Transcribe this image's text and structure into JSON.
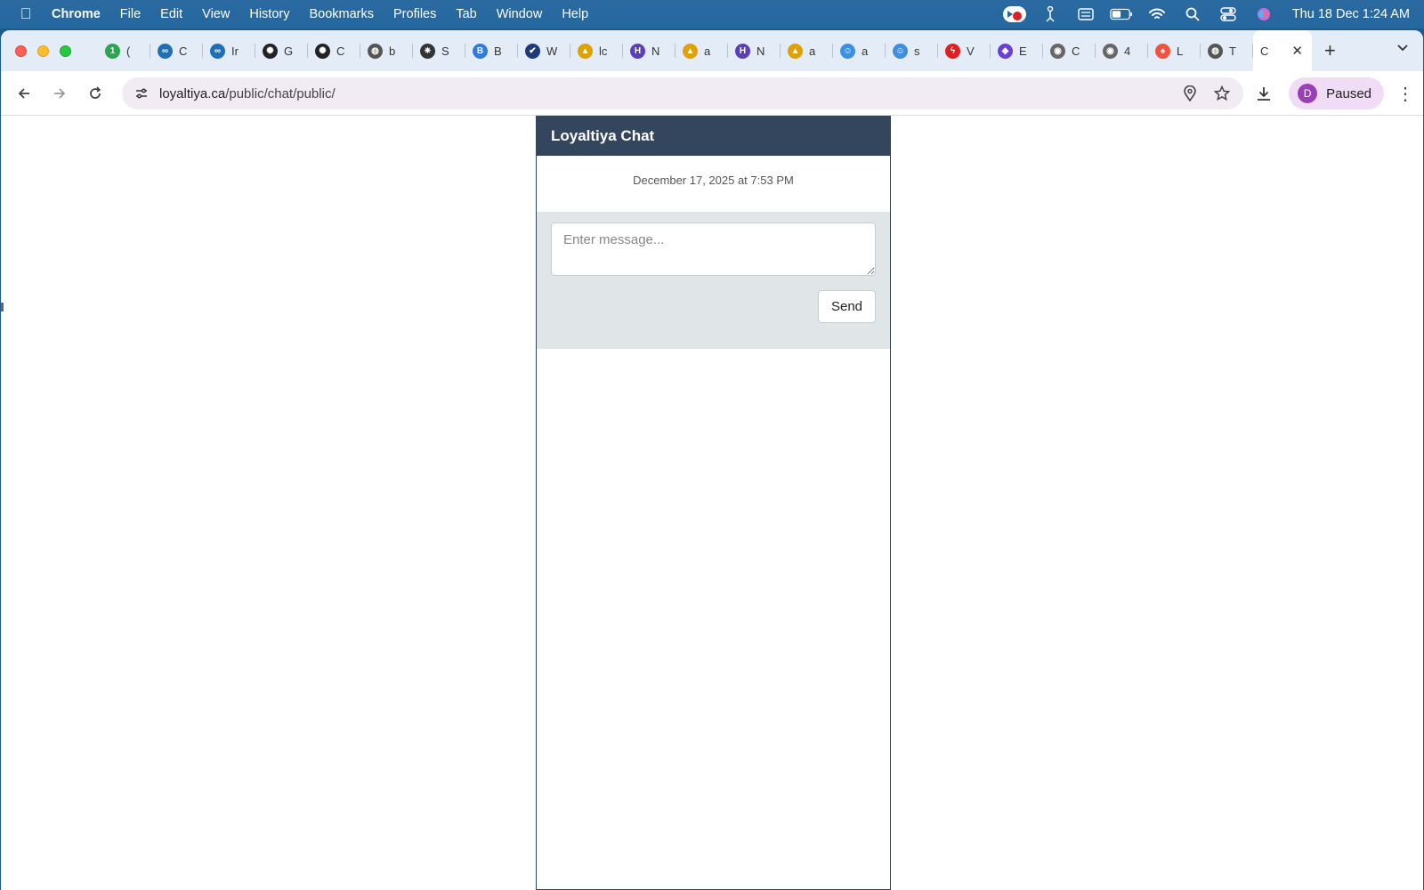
{
  "menubar": {
    "app": "Chrome",
    "items": [
      "File",
      "Edit",
      "View",
      "History",
      "Bookmarks",
      "Profiles",
      "Tab",
      "Window",
      "Help"
    ],
    "clock": "Thu 18 Dec  1:24 AM"
  },
  "tabs": [
    {
      "letter": "(",
      "icon": "green-number-icon",
      "color": "#2ea44f",
      "glyph": "1"
    },
    {
      "letter": "C",
      "icon": "blue-circle-icon",
      "color": "#1f6fb8",
      "glyph": "∞"
    },
    {
      "letter": "Ir",
      "icon": "blue-circle-icon",
      "color": "#1f6fb8",
      "glyph": "∞"
    },
    {
      "letter": "G",
      "icon": "openai-icon",
      "color": "#222222",
      "glyph": "✺"
    },
    {
      "letter": "C",
      "icon": "openai-icon",
      "color": "#222222",
      "glyph": "✺"
    },
    {
      "letter": "b",
      "icon": "globe-icon",
      "color": "#555555",
      "glyph": "◍"
    },
    {
      "letter": "S",
      "icon": "sparkle-icon",
      "color": "#333333",
      "glyph": "✷"
    },
    {
      "letter": "B",
      "icon": "b-icon",
      "color": "#2d7be0",
      "glyph": "B"
    },
    {
      "letter": "W",
      "icon": "check-icon",
      "color": "#1d3a7a",
      "glyph": "✔"
    },
    {
      "letter": "lc",
      "icon": "pma-icon",
      "color": "#e0a000",
      "glyph": "▲"
    },
    {
      "letter": "N",
      "icon": "h-icon",
      "color": "#5a3fb8",
      "glyph": "H"
    },
    {
      "letter": "a",
      "icon": "pma-icon",
      "color": "#e0a000",
      "glyph": "▲"
    },
    {
      "letter": "N",
      "icon": "h-icon",
      "color": "#5a3fb8",
      "glyph": "H"
    },
    {
      "letter": "a",
      "icon": "pma-icon",
      "color": "#e0a000",
      "glyph": "▲"
    },
    {
      "letter": "a",
      "icon": "blue-face-icon",
      "color": "#3d8fe0",
      "glyph": "☺"
    },
    {
      "letter": "s",
      "icon": "blue-face-icon",
      "color": "#3d8fe0",
      "glyph": "☺"
    },
    {
      "letter": "V",
      "icon": "red-bolt-icon",
      "color": "#e02020",
      "glyph": "ϟ"
    },
    {
      "letter": "E",
      "icon": "purple-icon",
      "color": "#6a3fd8",
      "glyph": "◈"
    },
    {
      "letter": "C",
      "icon": "gray-ghost-icon",
      "color": "#666666",
      "glyph": "◉"
    },
    {
      "letter": "4",
      "icon": "gray-ghost-icon",
      "color": "#666666",
      "glyph": "◉"
    },
    {
      "letter": "L",
      "icon": "laravel-icon",
      "color": "#f05340",
      "glyph": "♠"
    },
    {
      "letter": "T",
      "icon": "globe-icon",
      "color": "#555555",
      "glyph": "◍"
    }
  ],
  "active_tab": {
    "letter": "C",
    "close": "✕"
  },
  "omnibox": {
    "domain": "loyaltiya.ca",
    "path": "/public/chat/public/"
  },
  "profile": {
    "initial": "D",
    "label": "Paused"
  },
  "chat": {
    "title": "Loyaltiya Chat",
    "timestamp": "December 17, 2025 at 7:53 PM",
    "placeholder": "Enter message...",
    "send_label": "Send"
  }
}
